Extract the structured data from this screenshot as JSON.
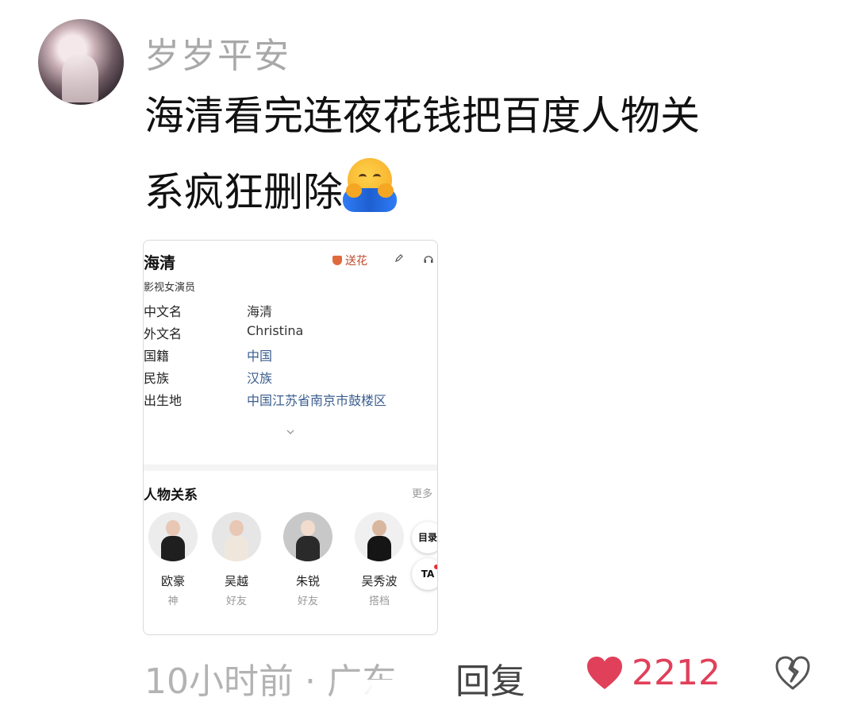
{
  "post": {
    "username": "岁岁平安",
    "comment_line1": "海清看完连夜花钱把百度人物关",
    "comment_line2": "系疯狂删除",
    "emoji": "hugging-face-emoji"
  },
  "card": {
    "title": "海清",
    "flower_label": "送花",
    "subtitle": "影视女演员",
    "info": [
      {
        "key": "中文名",
        "value": "海清"
      },
      {
        "key": "外文名",
        "value": "Christina"
      },
      {
        "key": "国籍",
        "value": "中国"
      },
      {
        "key": "民族",
        "value": "汉族"
      },
      {
        "key": "出生地",
        "value": "中国江苏省南京市鼓楼区"
      }
    ],
    "relations_title": "人物关系",
    "more_label": "更多",
    "people": [
      {
        "name": "欧豪",
        "role": "神"
      },
      {
        "name": "吴越",
        "role": "好友"
      },
      {
        "name": "朱锐",
        "role": "好友"
      },
      {
        "name": "吴秀波",
        "role": "搭档"
      }
    ],
    "toc_label": "目录",
    "ta_label": "TA"
  },
  "footer": {
    "meta": "10小时前 · 广东",
    "reply": "回复",
    "likes": "2212"
  },
  "colors": {
    "like": "#e0405a",
    "link": "#3b5e8f",
    "muted": "#b3b3b3"
  }
}
